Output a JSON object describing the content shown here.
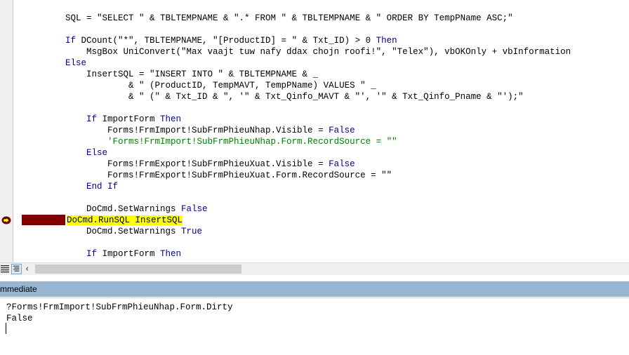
{
  "code_lines": [
    {
      "t": "    SQL = \"SELECT \" & TBLTEMPNAME & \".* FROM \" & TBLTEMPNAME & \" ORDER BY TempPName ASC;\""
    },
    {
      "t": ""
    },
    {
      "k": "    If ",
      "t": "DCount(\"*\", TBLTEMPNAME, \"[ProductID] = \" & Txt_ID) > 0 ",
      "k2": "Then"
    },
    {
      "t": "        MsgBox UniConvert(\"Max vaajt tuw nafy ddax chojn roofi!\", \"Telex\"), vbOKOnly + vbInformation"
    },
    {
      "k": "    Else"
    },
    {
      "t": "        InsertSQL = \"INSERT INTO \" & TBLTEMPNAME & _"
    },
    {
      "t": "                & \" (ProductID, TempMAVT, TempPName) VALUES \" _"
    },
    {
      "t": "                & \" (\" & Txt_ID & \", '\" & Txt_Qinfo_MAVT & \"', '\" & Txt_Qinfo_Pname & \"');\""
    },
    {
      "t": ""
    },
    {
      "k": "        If ",
      "t": "ImportForm ",
      "k2": "Then"
    },
    {
      "t": "            Forms!FrmImport!SubFrmPhieuNhap.Visible = ",
      "k2": "False"
    },
    {
      "c": "            'Forms!FrmImport!SubFrmPhieuNhap.Form.RecordSource = \"\""
    },
    {
      "k": "        Else"
    },
    {
      "t": "            Forms!FrmExport!SubFrmPhieuXuat.Visible = ",
      "k2": "False"
    },
    {
      "t": "            Forms!FrmExport!SubFrmPhieuXuat.Form.RecordSource = \"\""
    },
    {
      "k": "        End If"
    },
    {
      "t": ""
    },
    {
      "t": "        DoCmd.SetWarnings ",
      "k2": "False"
    },
    {
      "hl": "DoCmd.RunSQL InsertSQL"
    },
    {
      "t": "        DoCmd.SetWarnings ",
      "k2": "True"
    },
    {
      "t": ""
    },
    {
      "k": "        If ",
      "t": "ImportForm ",
      "k2": "Then"
    }
  ],
  "immediate": {
    "title": "mmediate",
    "lines": [
      "?Forms!FrmImport!SubFrmPhieuNhap.Form.Dirty",
      "False"
    ]
  },
  "icons": {
    "exec": "current-statement-arrow-icon",
    "proc_view": "procedure-view-icon",
    "full_view": "full-module-view-icon",
    "scroll_left": "scroll-left-icon"
  },
  "colors": {
    "keyword": "#00008b",
    "comment": "#008000",
    "breakpoint": "#800000",
    "highlight": "#ffff00",
    "title_bar": "#99b4d1"
  }
}
